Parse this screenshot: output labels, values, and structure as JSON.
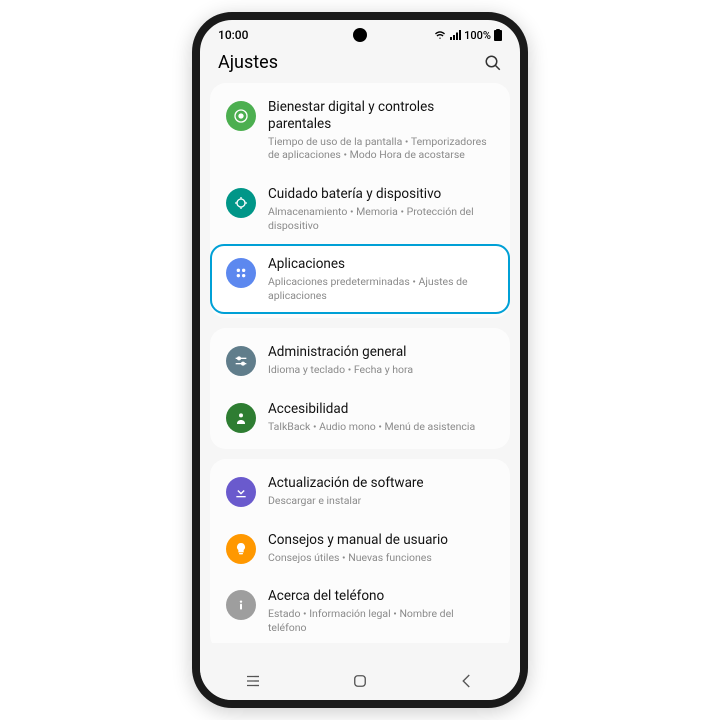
{
  "status": {
    "time": "10:00",
    "battery": "100%"
  },
  "header": {
    "title": "Ajustes"
  },
  "groups": [
    {
      "items": [
        {
          "id": "digital-wellbeing",
          "title": "Bienestar digital y controles parentales",
          "sub": "Tiempo de uso de la pantalla • Temporizadores de aplicaciones • Modo Hora de acostarse",
          "color": "#4caf50",
          "icon": "target",
          "highlight": false
        },
        {
          "id": "device-care",
          "title": "Cuidado batería y dispositivo",
          "sub": "Almacenamiento • Memoria • Protección del dispositivo",
          "color": "#009688",
          "icon": "care",
          "highlight": false
        },
        {
          "id": "apps",
          "title": "Aplicaciones",
          "sub": "Aplicaciones predeterminadas • Ajustes de aplicaciones",
          "color": "#5c88ef",
          "icon": "apps",
          "highlight": true
        }
      ]
    },
    {
      "items": [
        {
          "id": "general",
          "title": "Administración general",
          "sub": "Idioma y teclado • Fecha y hora",
          "color": "#607d8b",
          "icon": "sliders",
          "highlight": false
        },
        {
          "id": "accessibility",
          "title": "Accesibilidad",
          "sub": "TalkBack • Audio mono • Menú de asistencia",
          "color": "#2e7d32",
          "icon": "person",
          "highlight": false
        }
      ]
    },
    {
      "items": [
        {
          "id": "software-update",
          "title": "Actualización de software",
          "sub": "Descargar e instalar",
          "color": "#6a5acd",
          "icon": "download",
          "highlight": false
        },
        {
          "id": "tips",
          "title": "Consejos y manual de usuario",
          "sub": "Consejos útiles • Nuevas funciones",
          "color": "#ff9800",
          "icon": "bulb",
          "highlight": false
        },
        {
          "id": "about",
          "title": "Acerca del teléfono",
          "sub": "Estado • Información legal • Nombre del teléfono",
          "color": "#9e9e9e",
          "icon": "info",
          "highlight": false
        }
      ]
    }
  ]
}
